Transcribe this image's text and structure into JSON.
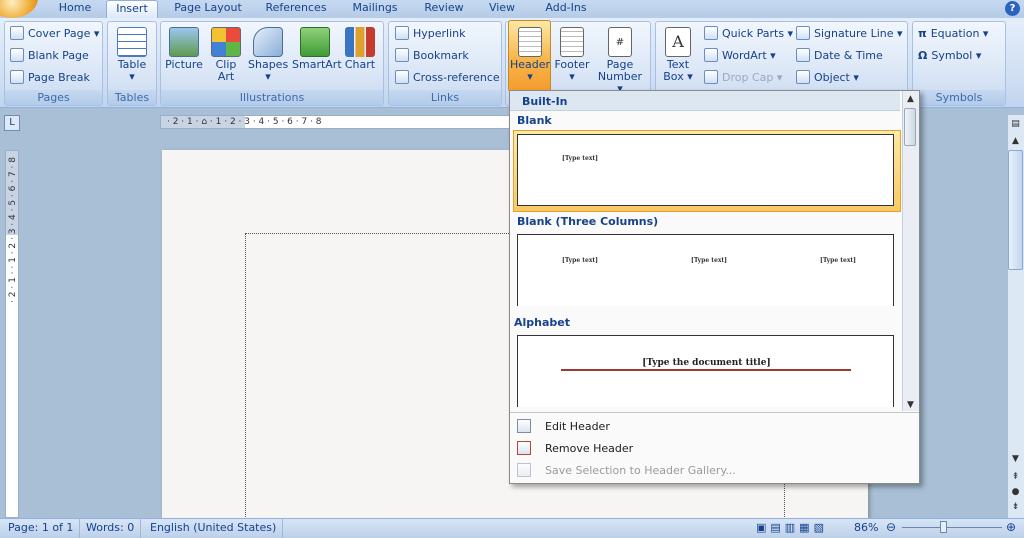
{
  "tabs": [
    "Home",
    "Insert",
    "Page Layout",
    "References",
    "Mailings",
    "Review",
    "View",
    "Add-Ins"
  ],
  "active_tab": "Insert",
  "help_label": "?",
  "ribbon": {
    "pages": {
      "label": "Pages",
      "items": [
        "Cover Page",
        "Blank Page",
        "Page Break"
      ]
    },
    "tables": {
      "label": "Tables",
      "table": "Table"
    },
    "illustrations": {
      "label": "Illustrations",
      "items": [
        "Picture",
        "Clip Art",
        "Shapes",
        "SmartArt",
        "Chart"
      ]
    },
    "links": {
      "label": "Links",
      "items": [
        "Hyperlink",
        "Bookmark",
        "Cross-reference"
      ]
    },
    "header_footer": {
      "items": [
        "Header",
        "Footer",
        "Page Number"
      ]
    },
    "text": {
      "text_box": "Text Box",
      "quick_parts": "Quick Parts",
      "wordart": "WordArt",
      "drop_cap": "Drop Cap",
      "signature_line": "Signature Line",
      "date_time": "Date & Time",
      "object": "Object"
    },
    "symbols": {
      "label": "Symbols",
      "equation": "Equation",
      "symbol": "Symbol"
    }
  },
  "gallery": {
    "section": "Built-In",
    "items": [
      {
        "name": "Blank",
        "texts": [
          "[Type text]"
        ]
      },
      {
        "name": "Blank (Three Columns)",
        "texts": [
          "[Type text]",
          "[Type text]",
          "[Type text]"
        ]
      },
      {
        "name": "Alphabet",
        "texts": [
          "[Type the document title]"
        ]
      }
    ],
    "menu": [
      "Edit Header",
      "Remove Header",
      "Save Selection to Header Gallery..."
    ]
  },
  "ruler": {
    "h": "· 2 · 1 · ⌂ · 1 · 2 · 3 · 4 · 5 · 6 · 7 · 8",
    "v": "· 2 · 1 · · 1 · 2 · 3 · 4 · 5 · 6 · 7 · 8"
  },
  "status": {
    "page": "Page: 1 of 1",
    "words": "Words: 0",
    "language": "English (United States)",
    "zoom": "86%"
  }
}
